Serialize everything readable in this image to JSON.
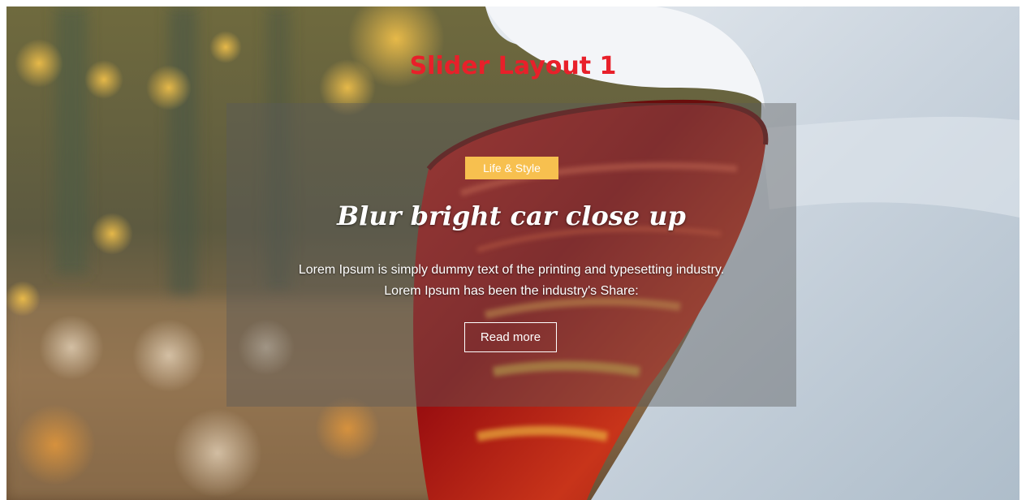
{
  "slider": {
    "title": "Slider Layout 1",
    "slide": {
      "category": "Life & Style",
      "heading": "Blur bright car close up",
      "description": "Lorem Ipsum is simply dummy text of the printing and typesetting industry. Lorem Ipsum has been the industry's Share:",
      "button_label": "Read more"
    }
  },
  "colors": {
    "title": "#e8202a",
    "badge": "#f7c04f",
    "caption_overlay": "rgba(90,90,90,0.42)"
  }
}
